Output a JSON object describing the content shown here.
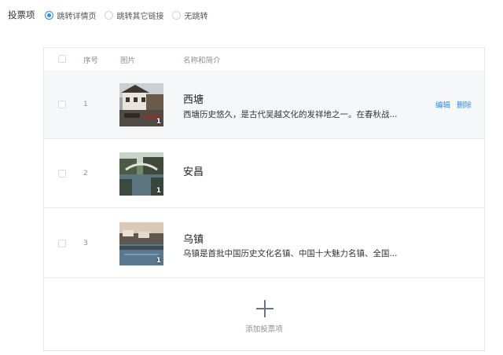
{
  "vote": {
    "label": "投票项",
    "options": [
      {
        "label": "跳转详情页",
        "checked": true
      },
      {
        "label": "跳转其它链接",
        "checked": false
      },
      {
        "label": "无跳转",
        "checked": false
      }
    ]
  },
  "table": {
    "headers": {
      "seq": "序号",
      "image": "图片",
      "name": "名称和简介"
    },
    "rows": [
      {
        "seq": "1",
        "title": "西塘",
        "desc": "西塘历史悠久，是古代吴越文化的发祥地之一。在春秋战...",
        "count": "1",
        "edit": "编辑",
        "delete": "删除"
      },
      {
        "seq": "2",
        "title": "安昌",
        "desc": "",
        "count": "1"
      },
      {
        "seq": "3",
        "title": "乌镇",
        "desc": "乌镇是首批中国历史文化名镇、中国十大魅力名镇、全国...",
        "count": "1"
      }
    ]
  },
  "add": {
    "label": "添加投票项"
  },
  "colors": {
    "accent": "#2d8cf0",
    "border": "#e3e6ea",
    "hover_row": "#f6f7f9"
  }
}
